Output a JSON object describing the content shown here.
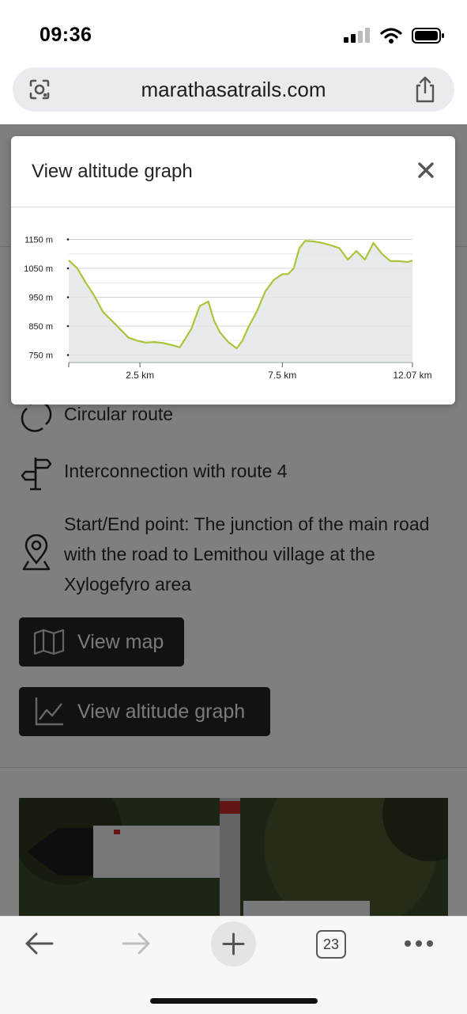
{
  "status": {
    "time": "09:36"
  },
  "browser": {
    "url": "marathasatrails.com",
    "tab_count": "23"
  },
  "features": [
    {
      "icon": "circular-route-icon",
      "text": "Circular route"
    },
    {
      "icon": "signpost-icon",
      "text": "Interconnection with route 4"
    },
    {
      "icon": "location-pin-icon",
      "text": "Start/End point: The junction of the main road with the road to Lemithou village at the Xylogefyro area"
    }
  ],
  "buttons": {
    "view_map": "View map",
    "view_altitude": "View altitude graph"
  },
  "modal": {
    "title": "View altitude graph",
    "close_icon": "close-icon"
  },
  "colors": {
    "line": "#a9c53a",
    "area": "#e4e7e9",
    "button": "#212529"
  },
  "chart_data": {
    "type": "area",
    "title": "",
    "xlabel": "",
    "ylabel": "",
    "xlim": [
      0,
      12.07
    ],
    "ylim": [
      735,
      1165
    ],
    "y_ticks": [
      "750 m",
      "850 m",
      "950 m",
      "1050 m",
      "1150 m"
    ],
    "x_ticks": [
      "2.5 km",
      "7.5 km",
      "12.07 km"
    ],
    "x_tick_values": [
      2.5,
      7.5,
      12.07
    ],
    "y_tick_values": [
      750,
      850,
      950,
      1050,
      1150
    ],
    "grid": true,
    "x": [
      0,
      0.3,
      0.6,
      0.9,
      1.2,
      1.5,
      1.8,
      2.1,
      2.4,
      2.7,
      3.0,
      3.3,
      3.6,
      3.9,
      4.1,
      4.3,
      4.6,
      4.9,
      5.1,
      5.3,
      5.6,
      5.9,
      6.1,
      6.3,
      6.6,
      6.9,
      7.2,
      7.5,
      7.7,
      7.9,
      8.1,
      8.3,
      8.6,
      8.9,
      9.2,
      9.5,
      9.8,
      10.1,
      10.4,
      10.7,
      11.0,
      11.3,
      11.6,
      11.9,
      12.07
    ],
    "y": [
      1078,
      1050,
      1000,
      955,
      900,
      870,
      840,
      810,
      800,
      793,
      795,
      792,
      785,
      777,
      808,
      840,
      920,
      935,
      870,
      830,
      795,
      773,
      800,
      845,
      900,
      970,
      1010,
      1030,
      1030,
      1050,
      1120,
      1145,
      1143,
      1138,
      1130,
      1120,
      1080,
      1110,
      1080,
      1138,
      1100,
      1075,
      1075,
      1072,
      1077
    ]
  }
}
